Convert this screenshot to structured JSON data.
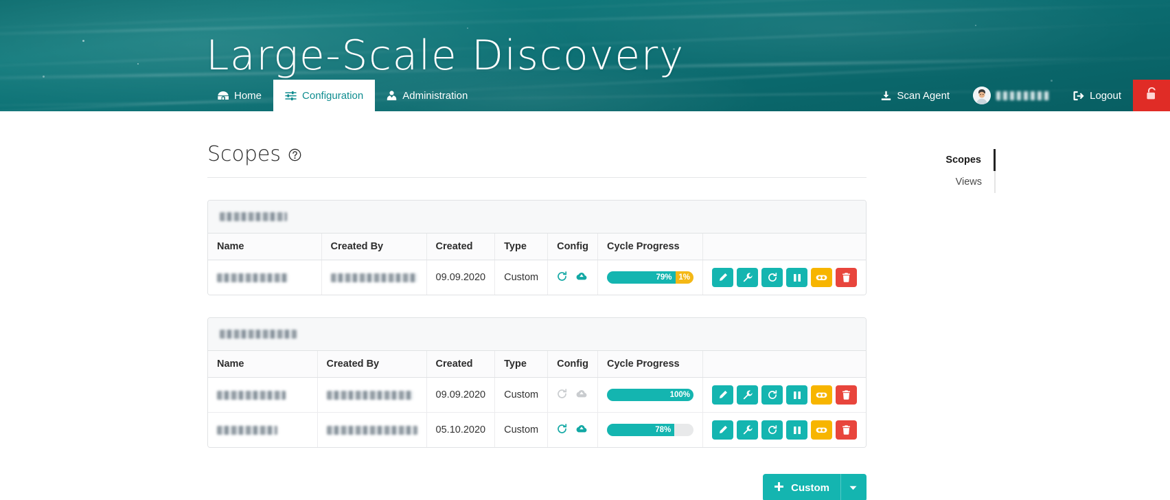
{
  "header": {
    "site_title": "Large-Scale Discovery",
    "nav_left": [
      {
        "label": "Home",
        "icon": "igloo-icon",
        "active": false
      },
      {
        "label": "Configuration",
        "icon": "sliders-icon",
        "active": true
      },
      {
        "label": "Administration",
        "icon": "user-tie-icon",
        "active": false
      }
    ],
    "nav_right": [
      {
        "label": "Scan Agent",
        "icon": "download-icon"
      },
      {
        "label": "Logout",
        "icon": "sign-out-icon"
      }
    ],
    "user": {
      "name_redacted": "████████",
      "avatar": "user-avatar"
    },
    "lock_button": {
      "icon": "unlock-icon",
      "color": "#e02c26"
    }
  },
  "page": {
    "title": "Scopes",
    "help_icon": "help-circle-icon"
  },
  "sidenav": {
    "items": [
      {
        "label": "Scopes",
        "active": true
      },
      {
        "label": "Views",
        "active": false
      }
    ]
  },
  "columns": [
    "Name",
    "Created By",
    "Created",
    "Type",
    "Config",
    "Cycle Progress",
    ""
  ],
  "panels": [
    {
      "heading_redacted": "██████ █████",
      "heading_width": 98,
      "rows": [
        {
          "name_redacted": "████████",
          "name_width": 104,
          "created_by_redacted": "██████████",
          "created_by_width": 126,
          "created": "09.09.2020",
          "type": "Custom",
          "config": {
            "refresh_enabled": true,
            "upload_enabled": true
          },
          "progress": {
            "segments": [
              {
                "value": 79,
                "label": "79%",
                "color": "teal"
              },
              {
                "value": 1,
                "label": "1%",
                "color": "amber"
              }
            ]
          },
          "actions": [
            {
              "name": "edit",
              "icon": "pencil-icon",
              "color": "teal"
            },
            {
              "name": "settings",
              "icon": "wrench-icon",
              "color": "teal"
            },
            {
              "name": "restart",
              "icon": "redo-icon",
              "color": "teal"
            },
            {
              "name": "pause",
              "icon": "pause-icon",
              "color": "teal"
            },
            {
              "name": "anonymize",
              "icon": "mask-icon",
              "color": "amber"
            },
            {
              "name": "delete",
              "icon": "trash-icon",
              "color": "red"
            }
          ]
        }
      ]
    },
    {
      "heading_redacted": "██████ - ███ ███",
      "heading_width": 112,
      "rows": [
        {
          "name_redacted": "████████",
          "name_width": 100,
          "created_by_redacted": "██████████",
          "created_by_width": 126,
          "created": "09.09.2020",
          "type": "Custom",
          "config": {
            "refresh_enabled": false,
            "upload_enabled": false
          },
          "progress": {
            "segments": [
              {
                "value": 100,
                "label": "100%",
                "color": "teal"
              }
            ]
          },
          "actions": [
            {
              "name": "edit",
              "icon": "pencil-icon",
              "color": "teal"
            },
            {
              "name": "settings",
              "icon": "wrench-icon",
              "color": "teal"
            },
            {
              "name": "restart",
              "icon": "redo-icon",
              "color": "teal"
            },
            {
              "name": "pause",
              "icon": "pause-icon",
              "color": "teal"
            },
            {
              "name": "anonymize",
              "icon": "mask-icon",
              "color": "amber"
            },
            {
              "name": "delete",
              "icon": "trash-icon",
              "color": "red"
            }
          ]
        },
        {
          "name_redacted": "███████",
          "name_width": 88,
          "created_by_redacted": "███████████",
          "created_by_width": 132,
          "created": "05.10.2020",
          "type": "Custom",
          "config": {
            "refresh_enabled": true,
            "upload_enabled": true
          },
          "progress": {
            "segments": [
              {
                "value": 78,
                "label": "78%",
                "color": "teal"
              }
            ]
          },
          "actions": [
            {
              "name": "edit",
              "icon": "pencil-icon",
              "color": "teal"
            },
            {
              "name": "settings",
              "icon": "wrench-icon",
              "color": "teal"
            },
            {
              "name": "restart",
              "icon": "redo-icon",
              "color": "teal"
            },
            {
              "name": "pause",
              "icon": "pause-icon",
              "color": "teal"
            },
            {
              "name": "anonymize",
              "icon": "mask-icon",
              "color": "amber"
            },
            {
              "name": "delete",
              "icon": "trash-icon",
              "color": "red"
            }
          ]
        }
      ]
    }
  ],
  "footer": {
    "custom_button": {
      "label": "Custom",
      "plus_icon": "plus-icon",
      "caret_icon": "caret-down-icon"
    }
  },
  "colors": {
    "teal": "#14b5b0",
    "header_teal": "#0d7074",
    "amber": "#f7b500",
    "red": "#e8453c",
    "lock_red": "#e02c26"
  }
}
